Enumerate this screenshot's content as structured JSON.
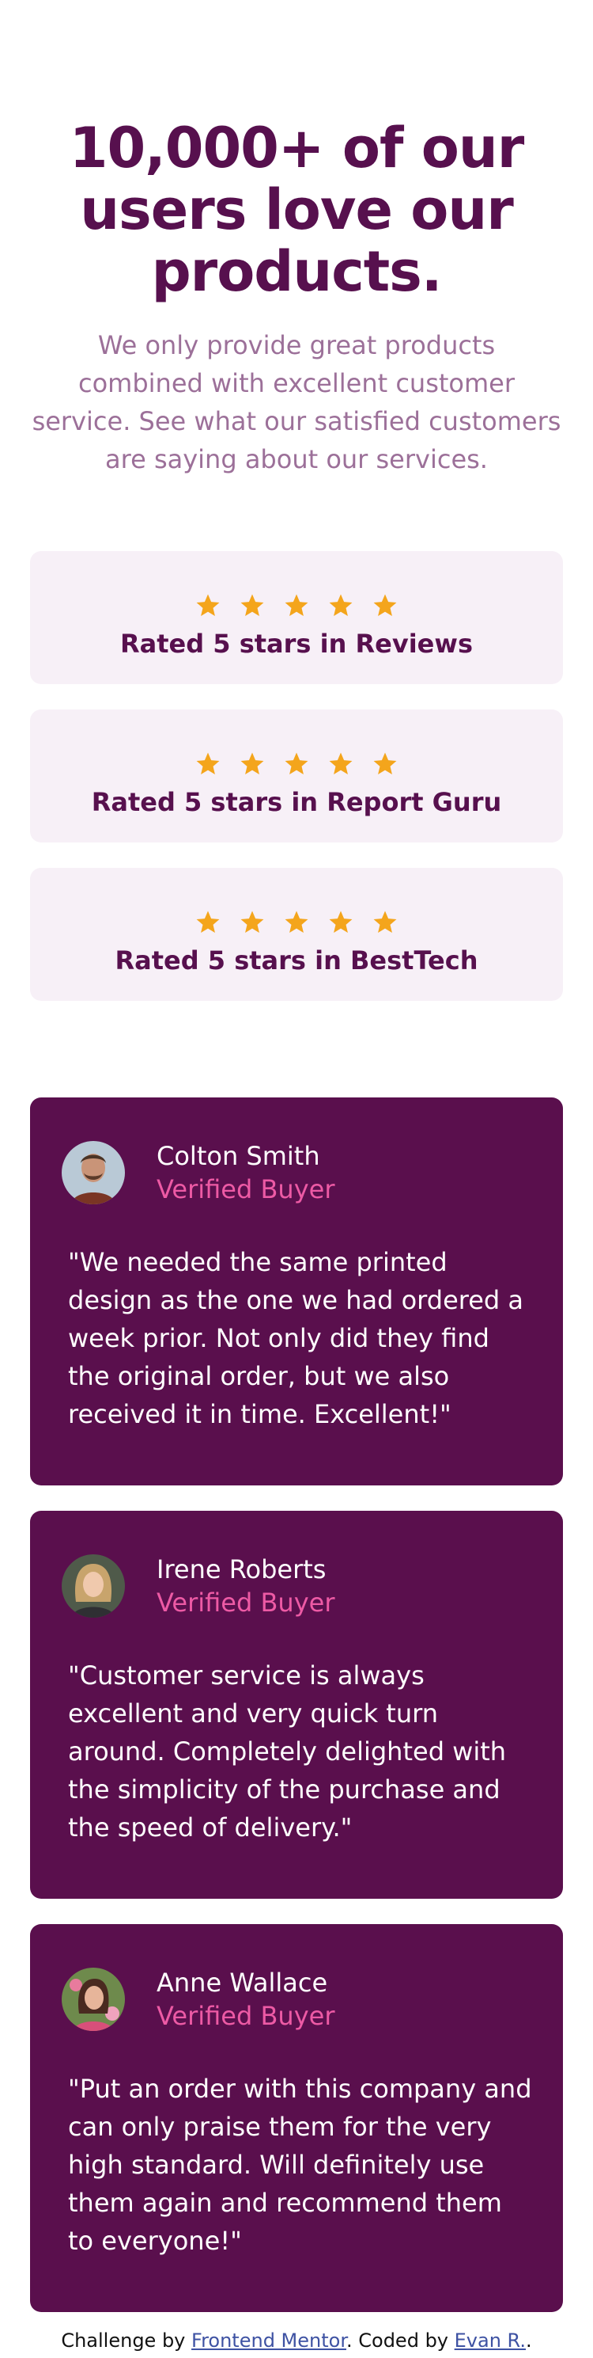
{
  "hero": {
    "title": "10,000+ of our users love our products.",
    "description": "We only provide great products combined with excellent customer service. See what our satisfied customers are saying about our services."
  },
  "ratings": [
    {
      "label": "Rated 5 stars in Reviews",
      "stars": 5
    },
    {
      "label": "Rated 5 stars in Report Guru",
      "stars": 5
    },
    {
      "label": "Rated 5 stars in BestTech",
      "stars": 5
    }
  ],
  "testimonials": [
    {
      "name": "Colton Smith",
      "status": "Verified Buyer",
      "quote": "\"We needed the same printed design as the one we had ordered a week prior. Not only did they find the original order, but we also received it in time. Excellent!\""
    },
    {
      "name": "Irene Roberts",
      "status": "Verified Buyer",
      "quote": "\"Customer service is always excellent and very quick turn around. Completely delighted with the simplicity of the purchase and the speed of delivery.\""
    },
    {
      "name": "Anne Wallace",
      "status": "Verified Buyer",
      "quote": "\"Put an order with this company and can only praise them for the very high standard. Will definitely use them again and recommend them to everyone!\""
    }
  ],
  "footer": {
    "prefix": "Challenge by ",
    "challenge_link": "Frontend Mentor",
    "middle": ". Coded by ",
    "author_link": "Evan R.",
    "suffix": "."
  },
  "colors": {
    "brand_dark": "#57104e",
    "brand_muted": "#9c7099",
    "card_bg": "#f7f0f7",
    "testimonial_bg": "#5a0f4d",
    "accent_pink": "#ed5aa5",
    "star": "#f4a51c"
  },
  "icons": {
    "star": "star-icon"
  }
}
